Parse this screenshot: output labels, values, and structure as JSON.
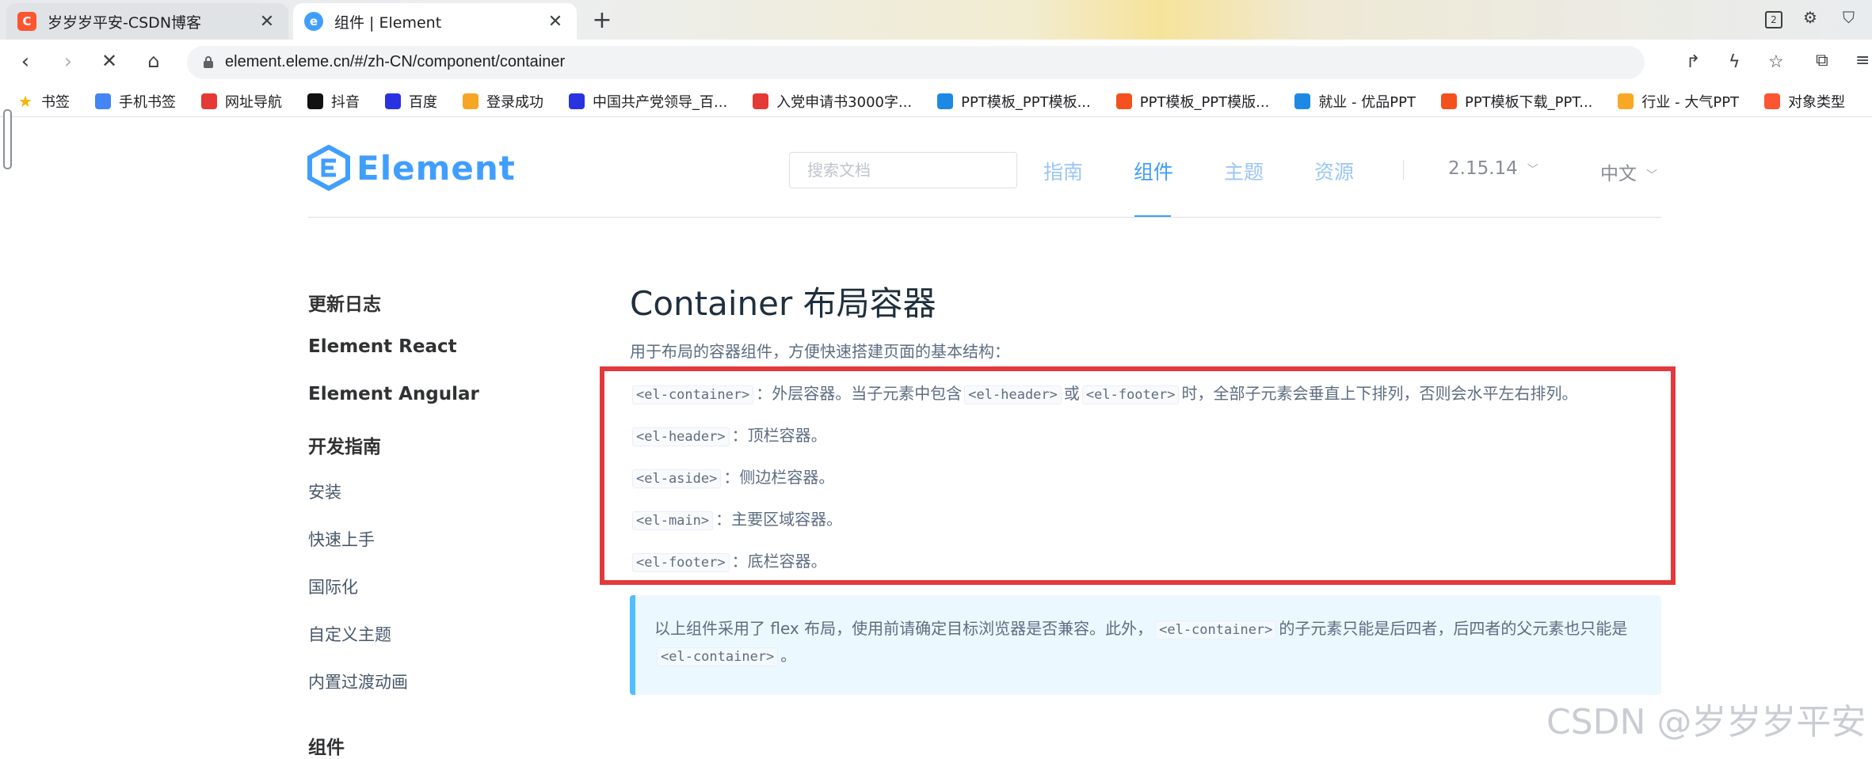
{
  "browser": {
    "tabs": [
      {
        "title": "岁岁岁平安-CSDN博客",
        "favicon": "C",
        "color": "#fc5531"
      },
      {
        "title": "组件 | Element",
        "favicon": "e",
        "color": "#409eff"
      }
    ],
    "url": "element.eleme.cn/#/zh-CN/component/container",
    "profile_badge": "2",
    "bookmarks": [
      {
        "label": "书签",
        "icon": "star-icon",
        "color": "#f4b400"
      },
      {
        "label": "手机书签",
        "icon": "phone-icon",
        "color": "#4285f4"
      },
      {
        "label": "网址导航",
        "icon": "nav-icon",
        "color": "#e53935"
      },
      {
        "label": "抖音",
        "icon": "douyin-icon",
        "color": "#111111"
      },
      {
        "label": "百度",
        "icon": "baidu-icon",
        "color": "#2932e1"
      },
      {
        "label": "登录成功",
        "icon": "ep-icon",
        "color": "#f5a623"
      },
      {
        "label": "中国共产党领导_百...",
        "icon": "baidu-icon",
        "color": "#2932e1"
      },
      {
        "label": "入党申请书3000字...",
        "icon": "8g-icon",
        "color": "#e53935"
      },
      {
        "label": "PPT模板_PPT模板...",
        "icon": "ppt-icon",
        "color": "#1e88e5"
      },
      {
        "label": "PPT模板_PPT模版...",
        "icon": "ppt-icon",
        "color": "#f4511e"
      },
      {
        "label": "就业 - 优品PPT",
        "icon": "youpin-icon",
        "color": "#1e88e5"
      },
      {
        "label": "PPT模板下载_PPT...",
        "icon": "ppt-icon",
        "color": "#f4511e"
      },
      {
        "label": "行业 - 大气PPT",
        "icon": "p-icon",
        "color": "#f9a825"
      },
      {
        "label": "对象类型",
        "icon": "csdn-icon",
        "color": "#fc5531"
      }
    ]
  },
  "header": {
    "logo": "Element",
    "search_placeholder": "搜索文档",
    "nav": [
      "指南",
      "组件",
      "主题",
      "资源"
    ],
    "active_nav": "组件",
    "version": "2.15.14",
    "language": "中文"
  },
  "sidebar": [
    {
      "label": "更新日志",
      "style": "strong"
    },
    {
      "label": "Element React",
      "style": "strong"
    },
    {
      "label": "Element Angular",
      "style": "strong"
    },
    {
      "label": "开发指南",
      "style": "strong"
    },
    {
      "label": "安装",
      "style": "light"
    },
    {
      "label": "快速上手",
      "style": "light"
    },
    {
      "label": "国际化",
      "style": "light"
    },
    {
      "label": "自定义主题",
      "style": "light"
    },
    {
      "label": "内置过渡动画",
      "style": "light"
    },
    {
      "label": "组件",
      "style": "strong"
    }
  ],
  "content": {
    "title": "Container 布局容器",
    "intro": "用于布局的容器组件，方便快速搭建页面的基本结构：",
    "items": [
      {
        "code": "<el-container>",
        "text": "：外层容器。当子元素中包含",
        "code2": "<el-header>",
        "mid": "或",
        "code3": "<el-footer>",
        "tail": "时，全部子元素会垂直上下排列，否则会水平左右排列。"
      },
      {
        "code": "<el-header>",
        "text": "：顶栏容器。"
      },
      {
        "code": "<el-aside>",
        "text": "：侧边栏容器。"
      },
      {
        "code": "<el-main>",
        "text": "：主要区域容器。"
      },
      {
        "code": "<el-footer>",
        "text": "：底栏容器。"
      }
    ],
    "tip": {
      "part1": "以上组件采用了 flex 布局，使用前请确定目标浏览器是否兼容。此外，",
      "code1": "<el-container>",
      "part2": "的子元素只能是后四者，后四者的父元素也只能是",
      "code2": "<el-container>",
      "part3": "。"
    }
  },
  "watermark": "CSDN @岁岁岁平安",
  "colors": {
    "accent": "#409eff",
    "highlight": "#e4393c",
    "tip_border": "#50bfff"
  }
}
